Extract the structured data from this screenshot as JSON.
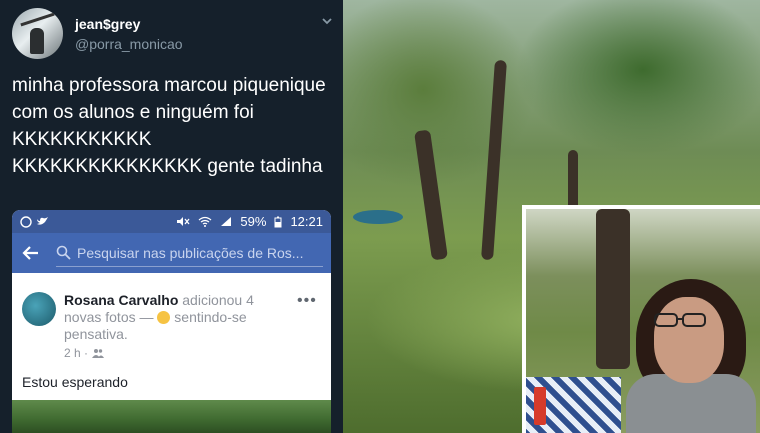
{
  "tweet": {
    "display_name": "jean$grey",
    "handle": "@porra_monicao",
    "text": "minha professora marcou piquenique com os alunos e ninguém foi KKKKKKKKKKK KKKKKKKKKKKKKKK gente tadinha"
  },
  "phone": {
    "status": {
      "battery": "59%",
      "time": "12:21"
    },
    "search": {
      "placeholder": "Pesquisar nas publicações de Ros..."
    },
    "post": {
      "author": "Rosana Carvalho",
      "action": " adicionou 4 novas fotos — ",
      "feeling": " sentindo-se pensativa.",
      "time": "2 h ·",
      "text": "Estou esperando"
    }
  },
  "colors": {
    "tweet_bg": "#15202b",
    "facebook_blue": "#4267b2"
  }
}
